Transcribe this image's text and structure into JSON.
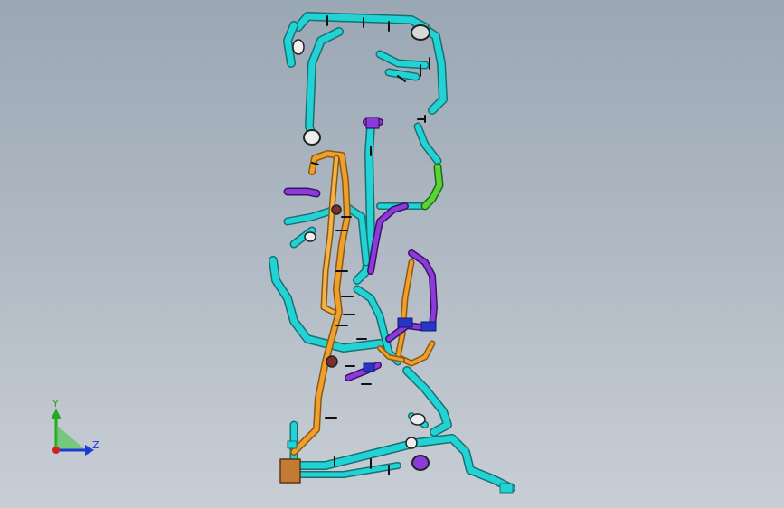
{
  "view": {
    "background_top": "#9aa7b4",
    "background_bottom": "#c9ced5"
  },
  "colors": {
    "pipe_cyan": "#22d3d6",
    "pipe_orange": "#f0a02a",
    "pipe_purple": "#8a3bd9",
    "pipe_green": "#5ad33a",
    "fitting_dark": "#222222",
    "clip_blue": "#2536c9"
  },
  "triad": {
    "y_label": "Y",
    "z_label": "Z",
    "y_color": "#22a822",
    "z_color": "#1b3ad6",
    "x_color": "#d22020"
  }
}
